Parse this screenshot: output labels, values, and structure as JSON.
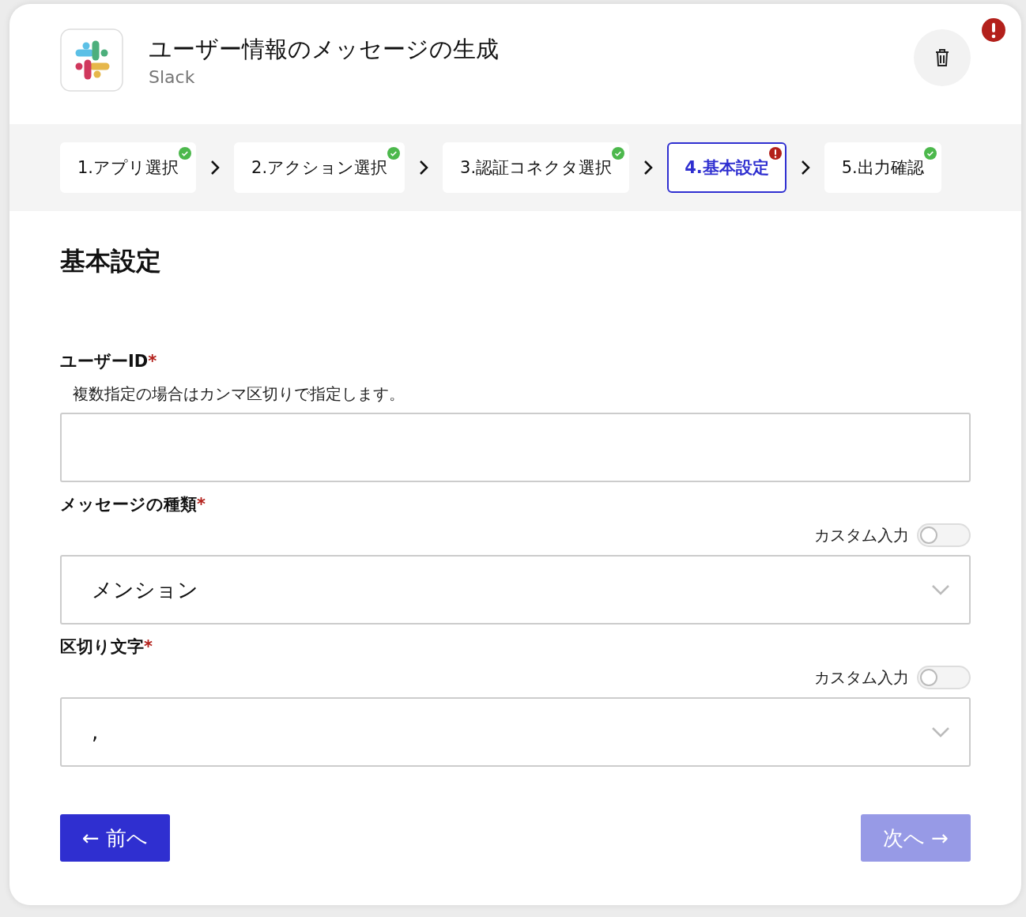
{
  "header": {
    "title": "ユーザー情報のメッセージの生成",
    "app_name": "Slack",
    "error": true
  },
  "steps": [
    {
      "label": "1.アプリ選択",
      "completed": true,
      "has_error": false,
      "selected": false
    },
    {
      "label": "2.アクション選択",
      "completed": true,
      "has_error": false,
      "selected": false
    },
    {
      "label": "3.認証コネクタ選択",
      "completed": true,
      "has_error": false,
      "selected": false
    },
    {
      "label": "4.基本設定",
      "completed": false,
      "has_error": true,
      "selected": true
    },
    {
      "label": "5.出力確認",
      "completed": true,
      "has_error": false,
      "selected": false
    }
  ],
  "section_title": "基本設定",
  "fields": [
    {
      "kind": "text",
      "label": "ユーザーID",
      "required_mark": "*",
      "hint": "複数指定の場合はカンマ区切りで指定します。"
    },
    {
      "kind": "select",
      "label": "メッセージの種類",
      "required_mark": "*",
      "toggle": {
        "label": "カスタム入力",
        "on": false
      },
      "value": "メンション"
    },
    {
      "kind": "select",
      "label": "区切り文字",
      "required_mark": "*",
      "toggle": {
        "label": "カスタム入力",
        "on": false
      },
      "value": ","
    }
  ],
  "buttons": [
    {
      "label": "← 前へ",
      "disabled": false
    },
    {
      "label": "次へ →",
      "disabled": true
    }
  ]
}
